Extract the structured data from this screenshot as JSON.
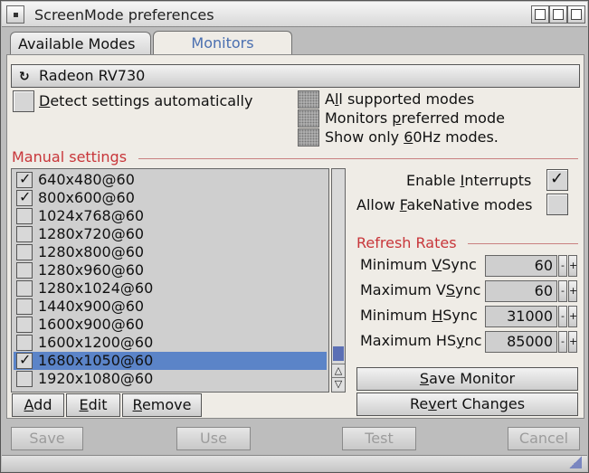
{
  "window": {
    "title": "ScreenMode preferences"
  },
  "tabs": [
    {
      "label": "Available Modes"
    },
    {
      "label": "Monitors"
    }
  ],
  "monitor": {
    "selected": "Radeon RV730"
  },
  "detect": {
    "label_u": "D",
    "label_rest": "etect settings automatically"
  },
  "filters": [
    {
      "pre": "A",
      "u": "l",
      "post": "l supported modes"
    },
    {
      "pre": "Monitors ",
      "u": "p",
      "post": "referred mode"
    },
    {
      "pre": "Show only ",
      "u": "6",
      "post": "0Hz modes."
    }
  ],
  "manual": {
    "title": "Manual settings"
  },
  "modes": [
    {
      "label": "640x480@60",
      "checked": true,
      "selected": false
    },
    {
      "label": "800x600@60",
      "checked": true,
      "selected": false
    },
    {
      "label": "1024x768@60",
      "checked": false,
      "selected": false
    },
    {
      "label": "1280x720@60",
      "checked": false,
      "selected": false
    },
    {
      "label": "1280x800@60",
      "checked": false,
      "selected": false
    },
    {
      "label": "1280x960@60",
      "checked": false,
      "selected": false
    },
    {
      "label": "1280x1024@60",
      "checked": false,
      "selected": false
    },
    {
      "label": "1440x900@60",
      "checked": false,
      "selected": false
    },
    {
      "label": "1600x900@60",
      "checked": false,
      "selected": false
    },
    {
      "label": "1600x1200@60",
      "checked": false,
      "selected": false
    },
    {
      "label": "1680x1050@60",
      "checked": true,
      "selected": true
    },
    {
      "label": "1920x1080@60",
      "checked": false,
      "selected": false
    }
  ],
  "list_buttons": {
    "add": {
      "u": "A",
      "rest": "dd"
    },
    "edit": {
      "u": "E",
      "rest": "dit"
    },
    "remove": {
      "u": "R",
      "rest": "emove"
    }
  },
  "options": {
    "interrupts": {
      "pre": "Enable ",
      "u": "I",
      "post": "nterrupts",
      "checked": true
    },
    "fakenative": {
      "pre": "Allow ",
      "u": "F",
      "post": "akeNative modes",
      "checked": false
    }
  },
  "refresh": {
    "title": "Refresh Rates",
    "rows": [
      {
        "pre": "Minimum ",
        "u": "V",
        "post": "Sync",
        "value": "60"
      },
      {
        "pre": "Maximum V",
        "u": "S",
        "post": "ync",
        "value": "60"
      },
      {
        "pre": "Minimum ",
        "u": "H",
        "post": "Sync",
        "value": "31000"
      },
      {
        "pre": "Maximum HS",
        "u": "y",
        "post": "nc",
        "value": "85000"
      }
    ]
  },
  "monitor_buttons": {
    "save": {
      "u": "S",
      "rest": "ave Monitor"
    },
    "revert": {
      "pre": "Re",
      "u": "v",
      "post": "ert Changes"
    }
  },
  "footer": {
    "save": "Save",
    "use": "Use",
    "test": "Test",
    "cancel": "Cancel"
  },
  "colors": {
    "accent": "#5b84c8",
    "section_title": "#c8363a",
    "tab_active_text": "#4a6fb0"
  }
}
